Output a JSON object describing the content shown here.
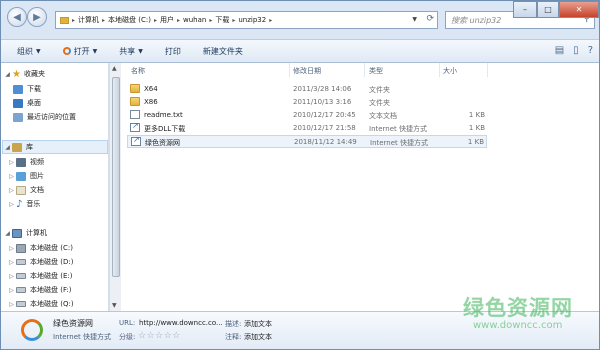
{
  "address": {
    "segments": [
      "计算机",
      "本地磁盘 (C:)",
      "用户",
      "wuhan",
      "下载",
      "unzip32"
    ]
  },
  "search": {
    "placeholder": "搜索 unzip32"
  },
  "window_buttons": {
    "minimize": "–",
    "maximize": "□",
    "close": "✕"
  },
  "toolbar": {
    "organize": "组织",
    "open": "打开",
    "share": "共享",
    "print": "打印",
    "new_folder": "新建文件夹"
  },
  "sidebar": {
    "favorites": "收藏夹",
    "downloads": "下载",
    "desktop": "桌面",
    "recent": "最近访问的位置",
    "libraries": "库",
    "videos": "视频",
    "pictures": "图片",
    "documents": "文档",
    "music": "音乐",
    "computer": "计算机",
    "drives": [
      "本地磁盘 (C:)",
      "本地磁盘 (D:)",
      "本地磁盘 (E:)",
      "本地磁盘 (F:)",
      "本地磁盘 (Q:)"
    ]
  },
  "columns": {
    "name": "名称",
    "date": "修改日期",
    "type": "类型",
    "size": "大小"
  },
  "files": [
    {
      "name": "X64",
      "date": "2011/3/28 14:06",
      "type": "文件夹",
      "size": "",
      "icon": "folder-icon"
    },
    {
      "name": "X86",
      "date": "2011/10/13 3:16",
      "type": "文件夹",
      "size": "",
      "icon": "folder-icon"
    },
    {
      "name": "readme.txt",
      "date": "2010/12/17 20:45",
      "type": "文本文档",
      "size": "1 KB",
      "icon": "text-file-icon"
    },
    {
      "name": "更多DLL下载",
      "date": "2010/12/17 21:58",
      "type": "Internet 快捷方式",
      "size": "1 KB",
      "icon": "internet-shortcut-icon"
    },
    {
      "name": "绿色资源网",
      "date": "2018/11/12 14:49",
      "type": "Internet 快捷方式",
      "size": "1 KB",
      "icon": "internet-shortcut-icon"
    }
  ],
  "details": {
    "name": "绿色资源网",
    "kind": "Internet 快捷方式",
    "url_label": "URL:",
    "url_value": "http://www.downcc.co...",
    "rating_label": "分级:",
    "rating_stars": "☆☆☆☆☆",
    "desc_label": "描述:",
    "desc_value": "添加文本",
    "note_label": "注释:",
    "note_value": "添加文本"
  },
  "watermark": {
    "title": "绿色资源网",
    "url": "www.downcc.com"
  },
  "colors": {
    "accent": "#3b8fd6",
    "watermark": "#3db558",
    "selection": "#e5f0fb"
  }
}
